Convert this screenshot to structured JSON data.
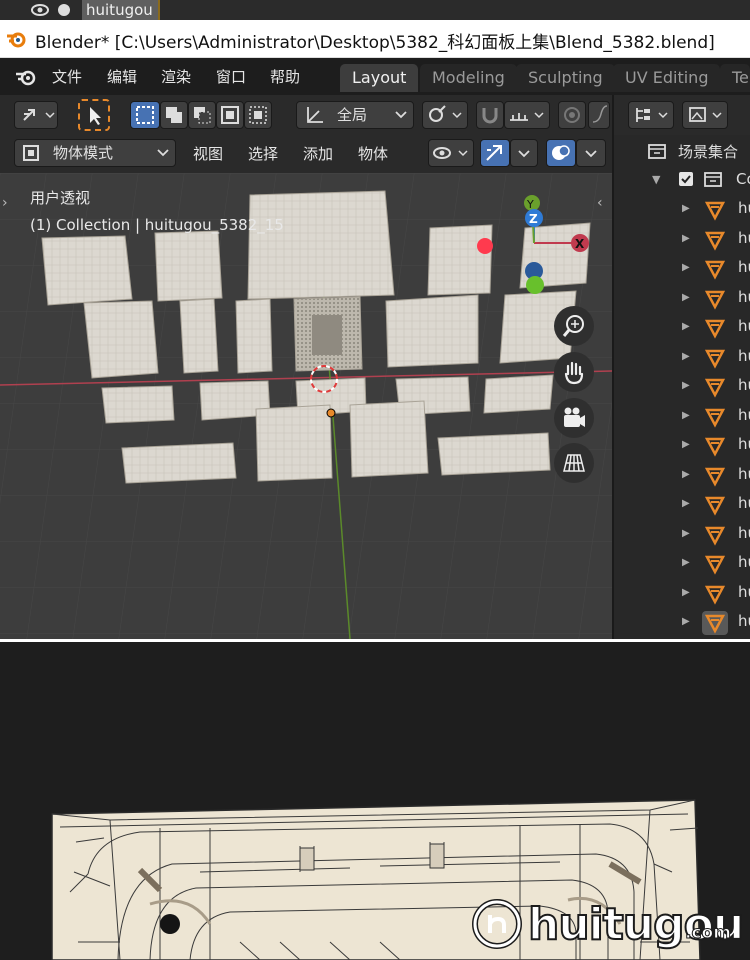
{
  "top_strip": {
    "object_name": "huitugou"
  },
  "window": {
    "title": "Blender* [C:\\Users\\Administrator\\Desktop\\5382_科幻面板上集\\Blend_5382.blend]"
  },
  "menu": {
    "items": [
      "文件",
      "编辑",
      "渲染",
      "窗口",
      "帮助"
    ]
  },
  "workspace_tabs": [
    {
      "label": "Layout",
      "active": true
    },
    {
      "label": "Modeling",
      "active": false
    },
    {
      "label": "Sculpting",
      "active": false
    },
    {
      "label": "UV Editing",
      "active": false
    },
    {
      "label": "Te",
      "active": false
    }
  ],
  "toolbar": {
    "orientation": "全局"
  },
  "header": {
    "mode": "物体模式",
    "menus": [
      "视图",
      "选择",
      "添加",
      "物体"
    ]
  },
  "viewport": {
    "view_name": "用户透视",
    "collection_info": "(1) Collection | huitugou_5382_15",
    "axis_labels": {
      "x": "X",
      "y": "Y",
      "z": "Z"
    }
  },
  "outliner": {
    "title": "场景集合",
    "collection_label": "Co",
    "object_label": "hu",
    "object_count": 15
  },
  "watermark": {
    "brand": "huitugou",
    "suffix": ".com"
  },
  "colors": {
    "accent": "#4772b3",
    "active_orange": "#e8892b",
    "x_axis": "#c03a4e",
    "y_axis": "#6aa02c",
    "z_axis": "#2f7bd6"
  }
}
